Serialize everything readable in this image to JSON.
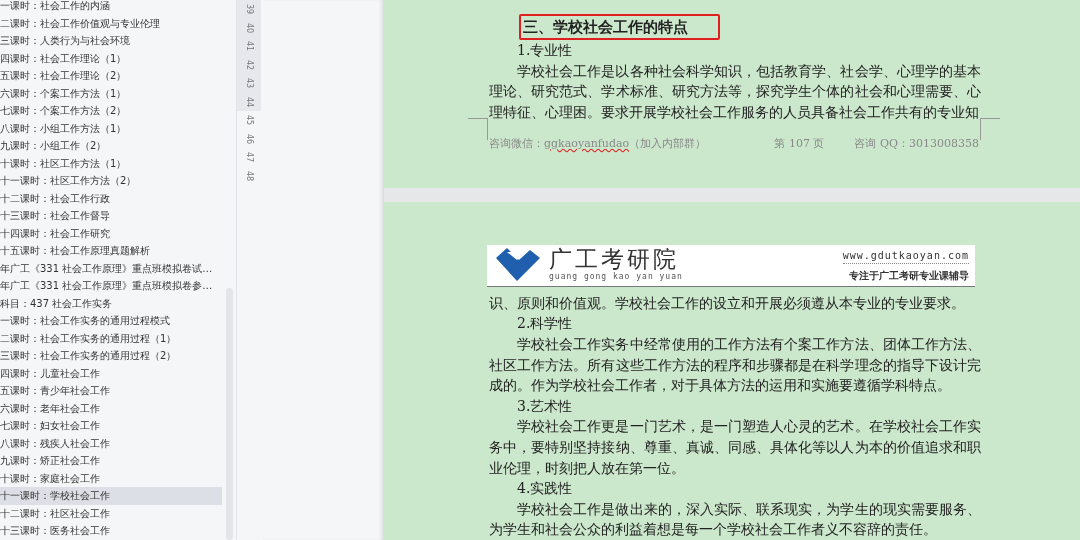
{
  "outline": {
    "items": [
      {
        "label": "一课时：社会工作的内涵",
        "selected": false
      },
      {
        "label": "二课时：社会工作价值观与专业伦理",
        "selected": false
      },
      {
        "label": "三课时：人类行为与社会环境",
        "selected": false
      },
      {
        "label": "四课时：社会工作理论（1）",
        "selected": false
      },
      {
        "label": "五课时：社会工作理论（2）",
        "selected": false
      },
      {
        "label": "六课时：个案工作方法（1）",
        "selected": false
      },
      {
        "label": "七课时：个案工作方法（2）",
        "selected": false
      },
      {
        "label": "八课时：小组工作方法（1）",
        "selected": false
      },
      {
        "label": "九课时：小组工作（2）",
        "selected": false
      },
      {
        "label": "十课时：社区工作方法（1）",
        "selected": false
      },
      {
        "label": "十一课时：社区工作方法（2）",
        "selected": false
      },
      {
        "label": "十二课时：社会工作行政",
        "selected": false
      },
      {
        "label": "十三课时：社会工作督导",
        "selected": false
      },
      {
        "label": "十四课时：社会工作研究",
        "selected": false
      },
      {
        "label": "十五课时：社会工作原理真题解析",
        "selected": false
      },
      {
        "label": "年广工《331 社会工作原理》重点班模拟卷试…",
        "selected": false
      },
      {
        "label": "年广工《331 社会工作原理》重点班模拟卷参…",
        "selected": false
      },
      {
        "label": "科目：437 社会工作实务",
        "selected": false
      },
      {
        "label": "一课时：社会工作实务的通用过程模式",
        "selected": false
      },
      {
        "label": "二课时：社会工作实务的通用过程（1）",
        "selected": false
      },
      {
        "label": "三课时：社会工作实务的通用过程（2）",
        "selected": false
      },
      {
        "label": "四课时：儿童社会工作",
        "selected": false
      },
      {
        "label": "五课时：青少年社会工作",
        "selected": false
      },
      {
        "label": "六课时：老年社会工作",
        "selected": false
      },
      {
        "label": "七课时：妇女社会工作",
        "selected": false
      },
      {
        "label": "八课时：残疾人社会工作",
        "selected": false
      },
      {
        "label": "九课时：矫正社会工作",
        "selected": false
      },
      {
        "label": "十课时：家庭社会工作",
        "selected": false
      },
      {
        "label": "十一课时：学校社会工作",
        "selected": true
      },
      {
        "label": "十二课时：社区社会工作",
        "selected": false
      },
      {
        "label": "十三课时：医务社会工作",
        "selected": false
      }
    ]
  },
  "page_strip": [
    {
      "label": "39",
      "in_view": true
    },
    {
      "label": "40",
      "in_view": true
    },
    {
      "label": "41",
      "in_view": true
    },
    {
      "label": "42",
      "in_view": true
    },
    {
      "label": "43",
      "in_view": true
    },
    {
      "label": "44",
      "in_view": true
    },
    {
      "label": "45",
      "in_view": false
    },
    {
      "label": "46",
      "in_view": false
    },
    {
      "label": "47",
      "in_view": false
    },
    {
      "label": "48",
      "in_view": false
    }
  ],
  "page_1": {
    "heading": "三、学校社会工作的特点",
    "heading_marked": true,
    "blocks": [
      {
        "kind": "subheading",
        "text": "1.专业性"
      },
      {
        "kind": "paragraph",
        "text": "学校社会工作是以各种社会科学知识，包括教育学、社会学、心理学的基本理论、研究范式、学术标准、研究方法等，探究学生个体的社会和心理需要、心理特征、心理困。要求开展学校社会工作服务的人员具备社会工作共有的专业知"
      }
    ],
    "footer": {
      "wechat_label": "咨询微信：",
      "wechat_id": "ggkaoyanfudao",
      "wechat_misspelled": true,
      "wechat_note": "（加入内部群）",
      "page": "第 107 页",
      "qq": "咨询 QQ：3013008358"
    }
  },
  "page_2": {
    "header": {
      "brand": "广工考研院",
      "pinyin": "guang gong kao yan yuan",
      "url": "www.gdutkaoyan.com",
      "slogan": "专注于广工考研专业课辅导"
    },
    "blocks": [
      {
        "kind": "continuation",
        "text": "识、原则和价值观。学校社会工作的设立和开展必须遵从本专业的专业要求。"
      },
      {
        "kind": "subheading",
        "text": "2.科学性"
      },
      {
        "kind": "paragraph",
        "text": "学校社会工作实务中经常使用的工作方法有个案工作方法、团体工作方法、社区工作方法。所有这些工作方法的程序和步骤都是在科学理念的指导下设计完成的。作为学校社会工作者，对于具体方法的运用和实施要遵循学科特点。"
      },
      {
        "kind": "subheading",
        "text": "3.艺术性"
      },
      {
        "kind": "paragraph",
        "text": "学校社会工作更是一门艺术，是一门塑造人心灵的艺术。在学校社会工作实务中，要特别坚持接纳、尊重、真诚、同感、具体化等以人为本的价值追求和职业伦理，时刻把人放在第一位。"
      },
      {
        "kind": "subheading",
        "text": "4.实践性"
      },
      {
        "kind": "paragraph",
        "text": "学校社会工作是做出来的，深入实际、联系现实，为学生的现实需要服务、为学生和社会公众的利益着想是每一个学校社会工作者义不容辞的责任。"
      }
    ]
  }
}
